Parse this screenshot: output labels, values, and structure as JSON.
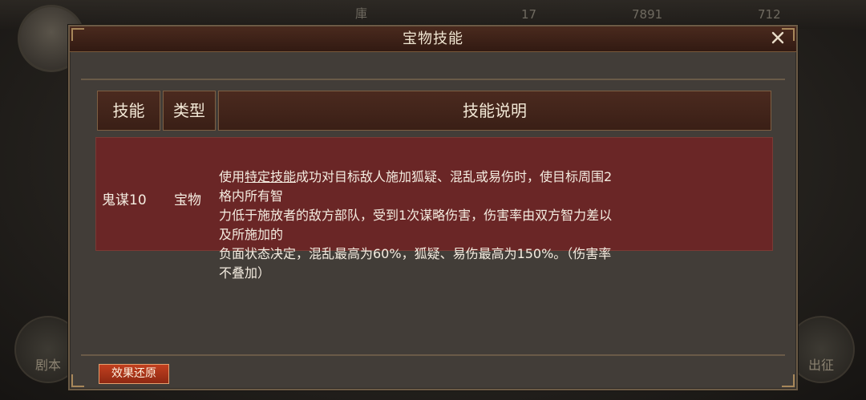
{
  "background": {
    "top_texts": [
      "庫",
      "17",
      "7891",
      "712"
    ],
    "left_round_label": "剧本",
    "right_round_label": "出征"
  },
  "dialog": {
    "title": "宝物技能",
    "close_icon": "close-icon",
    "table": {
      "headers": [
        "技能",
        "类型",
        "技能说明"
      ],
      "rows": [
        {
          "skill": "鬼谋10",
          "type": "宝物",
          "desc_prefix": "使用",
          "desc_link": "特定技能",
          "desc_line1_rest": "成功对目标敌人施加狐疑、混乱或易伤时，使目标周围2格内所有智",
          "desc_line2": "力低于施放者的敌方部队，受到1次谋略伤害，伤害率由双方智力差以及所施加的",
          "desc_line3": "负面状态决定，混乱最高为60%，狐疑、易伤最高为150%。（伤害率不叠加）"
        }
      ]
    },
    "restore_button": "效果还原"
  },
  "colors": {
    "title_bar": "#3f2218",
    "row_bg": "#6a2626",
    "button": "#b2371b"
  }
}
